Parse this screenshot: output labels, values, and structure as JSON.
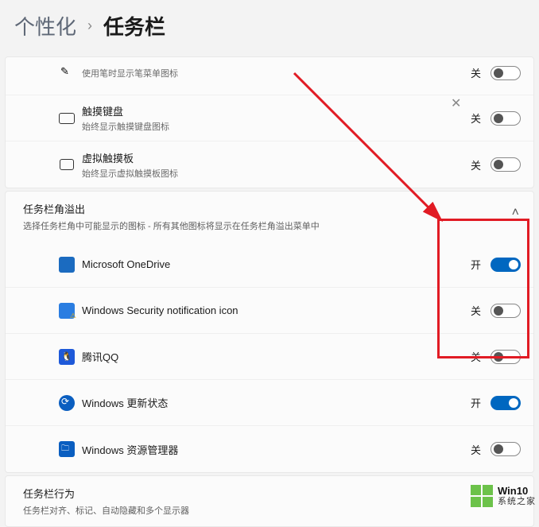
{
  "breadcrumb": {
    "parent": "个性化",
    "separator": "›",
    "current": "任务栏"
  },
  "topItems": [
    {
      "title": "",
      "desc": "使用笔时显示笔菜单图标",
      "state": "关",
      "on": false,
      "iconName": "pen-menu-icon",
      "partial": true
    },
    {
      "title": "触摸键盘",
      "desc": "始终显示触摸键盘图标",
      "state": "关",
      "on": false,
      "iconName": "touch-keyboard-icon"
    },
    {
      "title": "虚拟触摸板",
      "desc": "始终显示虚拟触摸板图标",
      "state": "关",
      "on": false,
      "iconName": "virtual-touchpad-icon"
    }
  ],
  "overflowSection": {
    "title": "任务栏角溢出",
    "desc": "选择任务栏角中可能显示的图标 - 所有其他图标将显示在任务栏角溢出菜单中"
  },
  "overflowItems": [
    {
      "title": "Microsoft OneDrive",
      "state": "开",
      "on": true,
      "iconClass": "icon-onedrive",
      "iconName": "onedrive-icon"
    },
    {
      "title": "Windows Security notification icon",
      "state": "关",
      "on": false,
      "iconClass": "icon-security",
      "iconName": "security-icon"
    },
    {
      "title": "腾讯QQ",
      "state": "关",
      "on": false,
      "iconClass": "icon-qq",
      "iconName": "qq-icon",
      "glyph": "🐧"
    },
    {
      "title": "Windows 更新状态",
      "state": "开",
      "on": true,
      "iconClass": "icon-update",
      "iconName": "windows-update-icon"
    },
    {
      "title": "Windows 资源管理器",
      "state": "关",
      "on": false,
      "iconClass": "icon-explorer",
      "iconName": "explorer-icon"
    }
  ],
  "behaviorSection": {
    "title": "任务栏行为",
    "desc": "任务栏对齐、标记、自动隐藏和多个显示器"
  },
  "watermark": {
    "line1": "Win10",
    "line2": "系统之家"
  },
  "stateLabels": {
    "on": "开",
    "off": "关"
  }
}
